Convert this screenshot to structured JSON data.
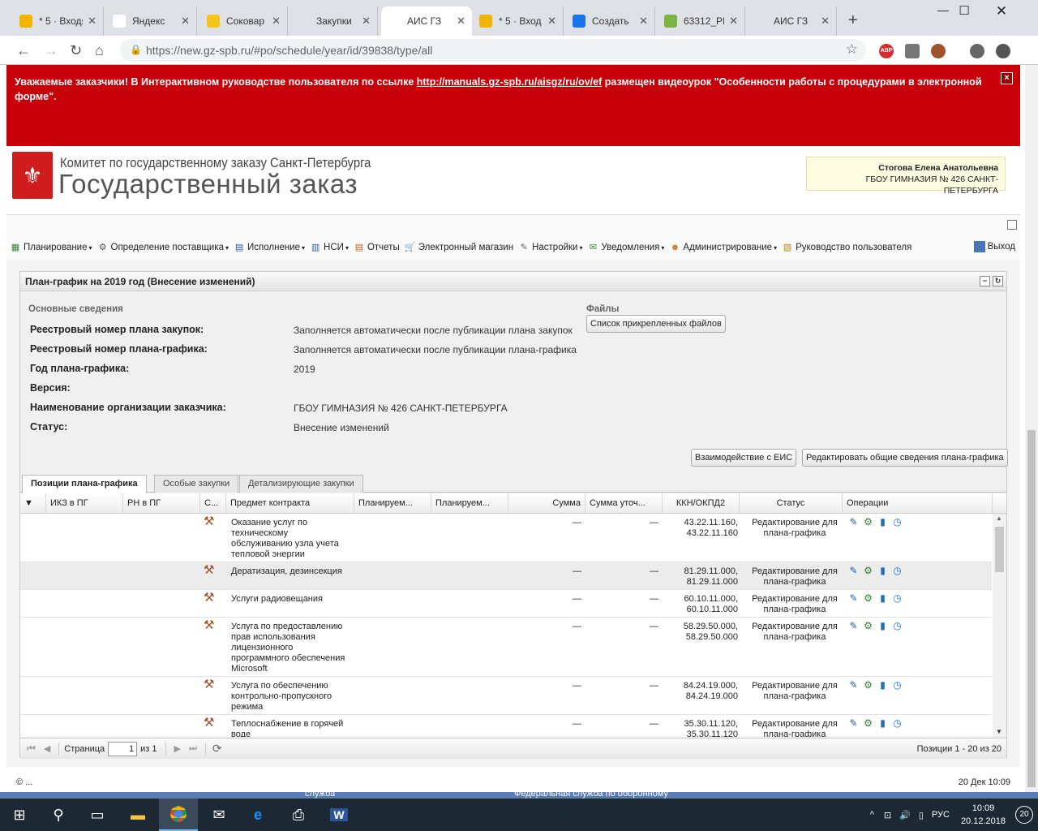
{
  "browser": {
    "tabs": [
      {
        "title": "* 5 · Входя",
        "icon": "mail-icon"
      },
      {
        "title": "Яндекс",
        "icon": "yandex-icon"
      },
      {
        "title": "Соковар",
        "icon": "sokovar-icon"
      },
      {
        "title": "Закупки",
        "icon": "gavel-icon"
      },
      {
        "title": "АИС ГЗ",
        "icon": "gavel-icon"
      },
      {
        "title": "* 5 · Вход",
        "icon": "mail-icon"
      },
      {
        "title": "Создать",
        "icon": "help-icon"
      },
      {
        "title": "63312_РІ",
        "icon": "image-icon"
      },
      {
        "title": "АИС ГЗ",
        "icon": "gavel-icon"
      }
    ],
    "active_tab": 4,
    "url": "https://new.gz-spb.ru/#po/schedule/year/id/39838/type/all"
  },
  "banner": {
    "text_before": "Уважаемые заказчики! В Интерактивном руководстве пользователя по ссылке ",
    "link": "http://manuals.gz-spb.ru/aisgz/ru/ov/ef",
    "text_after": " размещен видеоурок \"Особенности работы с процедурами в электронной форме\".",
    "close": "×"
  },
  "header": {
    "org_line1": "Комитет по государственному заказу Санкт-Петербурга",
    "org_line2": "Государственный заказ",
    "user_name": "Стогова Елена Анатольевна",
    "user_org": "ГБОУ ГИМНАЗИЯ № 426 САНКТ-ПЕТЕРБУРГА"
  },
  "menu": {
    "items": [
      {
        "label": "Планирование",
        "icon": "planning-icon",
        "dropdown": true
      },
      {
        "label": "Определение поставщика",
        "icon": "gears-icon",
        "dropdown": true
      },
      {
        "label": "Исполнение",
        "icon": "execution-icon",
        "dropdown": true
      },
      {
        "label": "НСИ",
        "icon": "book-icon",
        "dropdown": true
      },
      {
        "label": "Отчеты",
        "icon": "report-icon",
        "dropdown": false
      },
      {
        "label": "Электронный магазин",
        "icon": "cart-icon",
        "dropdown": false
      },
      {
        "label": "Настройки",
        "icon": "wrench-icon",
        "dropdown": true
      },
      {
        "label": "Уведомления",
        "icon": "notify-icon",
        "dropdown": true
      },
      {
        "label": "Администрирование",
        "icon": "user-icon",
        "dropdown": true
      },
      {
        "label": "Руководство пользователя",
        "icon": "manual-icon",
        "dropdown": false
      }
    ],
    "exit": "Выход"
  },
  "panel": {
    "title": "План-график на 2019 год (Внесение изменений)",
    "section_title": "Основные сведения",
    "fields": [
      {
        "label": "Реестровый номер плана закупок:",
        "value": "Заполняется автоматически после публикации плана закупок"
      },
      {
        "label": "Реестровый номер плана-графика:",
        "value": "Заполняется автоматически после публикации плана-графика"
      },
      {
        "label": "Год плана-графика:",
        "value": "2019"
      },
      {
        "label": "Версия:",
        "value": ""
      },
      {
        "label": "Наименование организации заказчика:",
        "value": "ГБОУ ГИМНАЗИЯ № 426 САНКТ-ПЕТЕРБУРГА"
      },
      {
        "label": "Статус:",
        "value": "Внесение изменений"
      }
    ],
    "files_title": "Файлы",
    "files_button": "Список прикрепленных файлов",
    "eis_button": "Взаимодействие с ЕИС",
    "edit_button": "Редактировать общие сведения плана-графика"
  },
  "tabs": [
    "Позиции плана-графика",
    "Особые закупки",
    "Детализирующие закупки"
  ],
  "grid": {
    "columns": [
      "ИКЗ в ПГ",
      "РН в ПГ",
      "С...",
      "Предмет контракта",
      "Планируем...",
      "Планируем...",
      "Сумма",
      "Сумма уточ...",
      "ККН/ОКПД2",
      "Статус",
      "Операции"
    ],
    "rows": [
      {
        "subject": "Оказание услуг по техническому обслуживанию узла учета тепловой энергии",
        "sum": "—",
        "sum2": "—",
        "okpd": "43.22.11.160, 43.22.11.160",
        "status": "Редактирование для плана-графика"
      },
      {
        "subject": "Дератизация, дезинсекция",
        "sum": "—",
        "sum2": "—",
        "okpd": "81.29.11.000, 81.29.11.000",
        "status": "Редактирование для плана-графика"
      },
      {
        "subject": "Услуги радиовещания",
        "sum": "—",
        "sum2": "—",
        "okpd": "60.10.11.000, 60.10.11.000",
        "status": "Редактирование для плана-графика"
      },
      {
        "subject": "Услуга по предоставлению прав использования лицензионного программного обеспечения Microsoft",
        "sum": "—",
        "sum2": "—",
        "okpd": "58.29.50.000, 58.29.50.000",
        "status": "Редактирование для плана-графика"
      },
      {
        "subject": "Услуга по обеспечению контрольно-пропускного режима",
        "sum": "—",
        "sum2": "—",
        "okpd": "84.24.19.000, 84.24.19.000",
        "status": "Редактирование для плана-графика"
      },
      {
        "subject": "Теплоснабжение в горячей воде",
        "sum": "—",
        "sum2": "—",
        "okpd": "35.30.11.120, 35.30.11.120",
        "status": "Редактирование для плана-графика"
      }
    ]
  },
  "pager": {
    "page_label": "Страница",
    "page": "1",
    "of_label": "из 1",
    "summary": "Позиции 1 - 20 из 20"
  },
  "statusbar": {
    "left": "© ...",
    "right": "20 Дек 10:09"
  },
  "bg_text": {
    "left": "служба",
    "right": "Федеральная служба по оборонному"
  },
  "taskbar": {
    "lang": "РУС",
    "time": "10:09",
    "date": "20.12.2018",
    "notif": "20"
  }
}
